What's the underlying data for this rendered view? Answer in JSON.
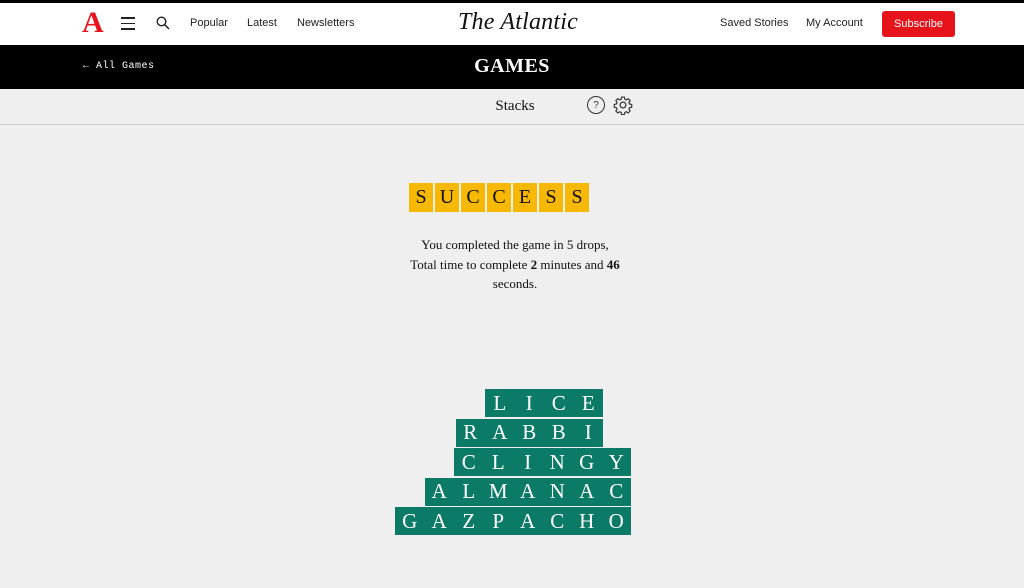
{
  "header": {
    "logo": "A",
    "nav": [
      "Popular",
      "Latest",
      "Newsletters"
    ],
    "brand": "The Atlantic",
    "saved_stories": "Saved Stories",
    "my_account": "My Account",
    "subscribe": "Subscribe"
  },
  "games_bar": {
    "back": "← All Games",
    "title": "GAMES"
  },
  "subbar": {
    "title": "Stacks",
    "help": "?"
  },
  "success": {
    "letters": [
      "S",
      "U",
      "C",
      "C",
      "E",
      "S",
      "S"
    ],
    "line1": "You completed the game in 5 drops,",
    "line2_prefix": "Total time to complete ",
    "minutes": "2",
    "line2_mid": " minutes and ",
    "seconds": "46",
    "line3": "seconds."
  },
  "stack": {
    "words": [
      "LICE",
      "RABBI",
      "CLINGY",
      "ALMANAC",
      "GAZPACHO"
    ]
  },
  "colors": {
    "accent_red": "#e7131a",
    "tile_yellow": "#f6b800",
    "tile_green": "#0b7a66"
  }
}
